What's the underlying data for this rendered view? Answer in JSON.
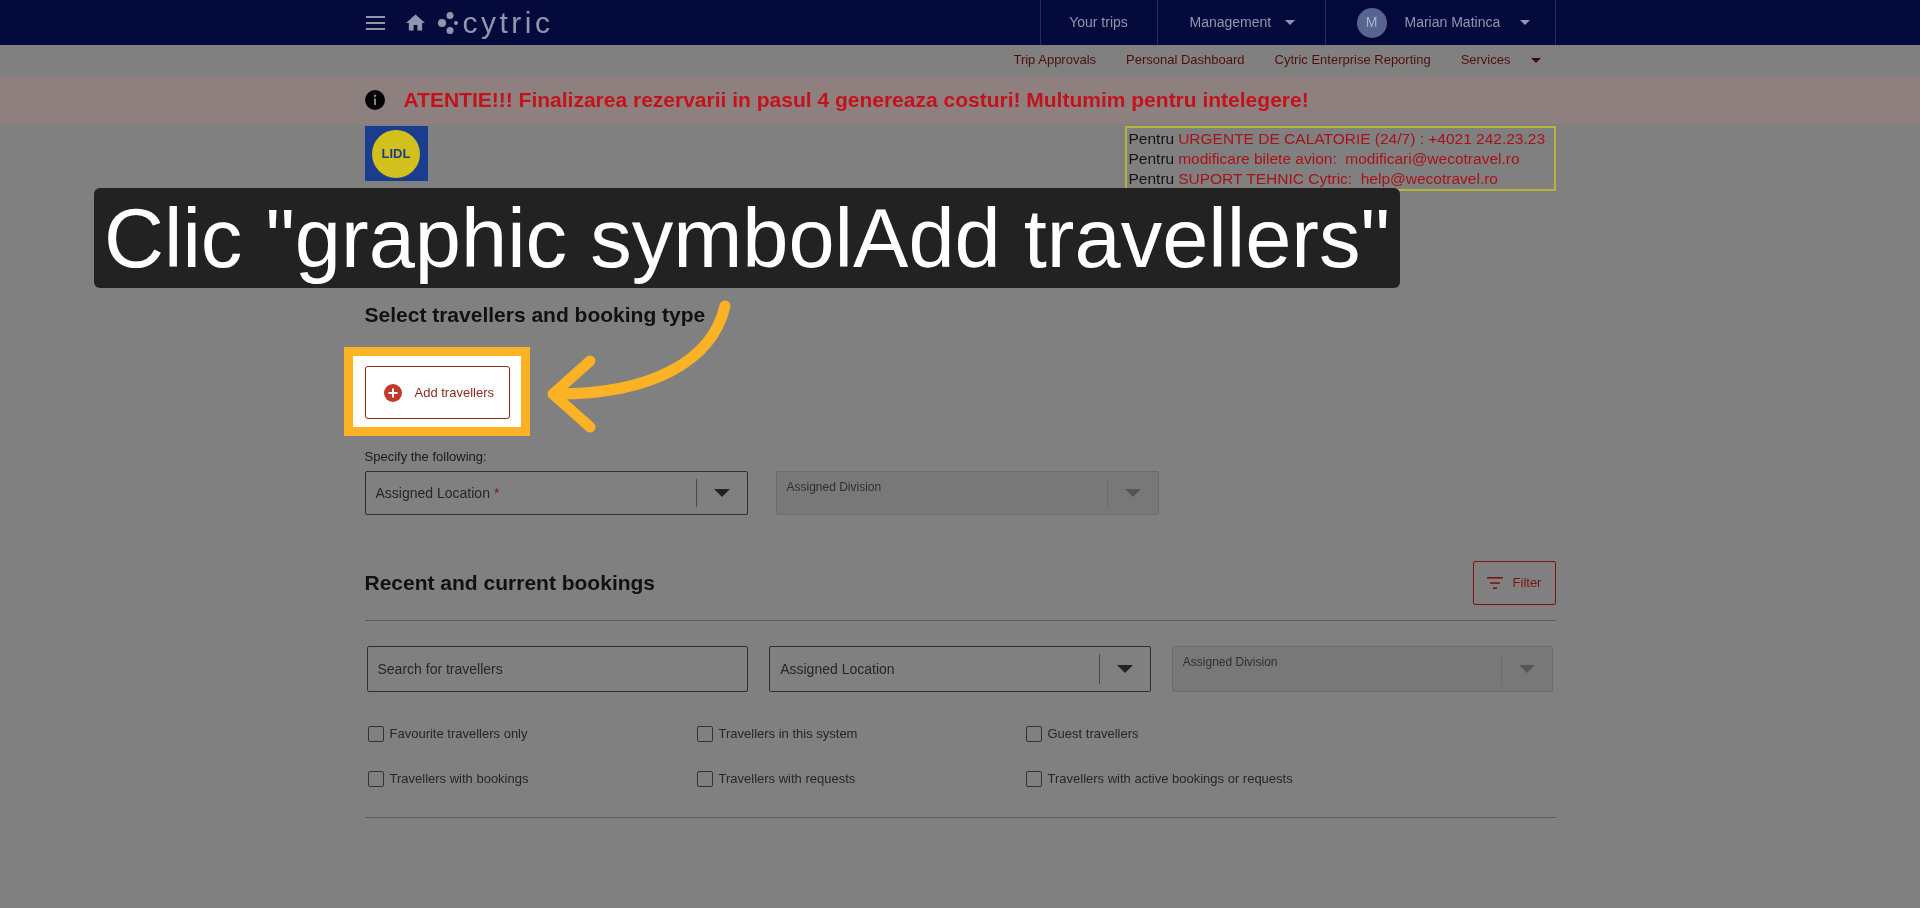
{
  "top_nav": {
    "logo_text": "cytric",
    "items": [
      {
        "label": "Your trips",
        "kind": "link"
      },
      {
        "label": "Management",
        "kind": "menu"
      }
    ],
    "user": {
      "initial": "M",
      "name": "Marian Matinca"
    }
  },
  "sub_nav": {
    "items": [
      {
        "label": "Trip Approvals",
        "kind": "link"
      },
      {
        "label": "Personal Dashboard",
        "kind": "link"
      },
      {
        "label": "Cytric Enterprise Reporting",
        "kind": "link"
      },
      {
        "label": "Services",
        "kind": "menu"
      }
    ]
  },
  "notice_banner": {
    "text": "ATENTIE!!! Finalizarea rezervarii in pasul 4 genereaza costuri! Multumim pentru intelegere!"
  },
  "company_logo": {
    "text": "LIDL"
  },
  "contact_box": {
    "lines": [
      {
        "prefix": "Pentru",
        "text": "URGENTE DE CALATORIE (24/7) : +4021 242.23.23"
      },
      {
        "prefix": "Pentru",
        "text": "modificare bilete avion:  modificari@wecotravel.ro"
      },
      {
        "prefix": "Pentru",
        "text": "SUPORT TEHNIC Cytric:  help@wecotravel.ro"
      }
    ]
  },
  "tutorial_caption": {
    "text": "Clic \"graphic symbolAdd travellers\""
  },
  "booking_section": {
    "heading": "Select travellers and booking type",
    "add_button": {
      "label": "Add travellers",
      "highlighted": true
    },
    "specify_label": "Specify the following:",
    "fields": [
      {
        "label": "Assigned Location",
        "required_mark": "*",
        "disabled": false
      },
      {
        "label": "Assigned Division",
        "disabled": true
      }
    ]
  },
  "bookings_section": {
    "heading": "Recent and current bookings",
    "filter_button": {
      "label": "Filter"
    },
    "search_field": {
      "placeholder": "Search for travellers"
    },
    "fields": [
      {
        "label": "Assigned Location",
        "disabled": false
      },
      {
        "label": "Assigned Division",
        "disabled": true
      }
    ],
    "checkboxes": [
      {
        "label": "Favourite travellers only",
        "checked": false
      },
      {
        "label": "Travellers in this system",
        "checked": false
      },
      {
        "label": "Guest travellers",
        "checked": false
      },
      {
        "label": "Travellers with bookings",
        "checked": false
      },
      {
        "label": "Travellers with requests",
        "checked": false
      },
      {
        "label": "Travellers with active bookings or requests",
        "checked": false
      }
    ]
  }
}
